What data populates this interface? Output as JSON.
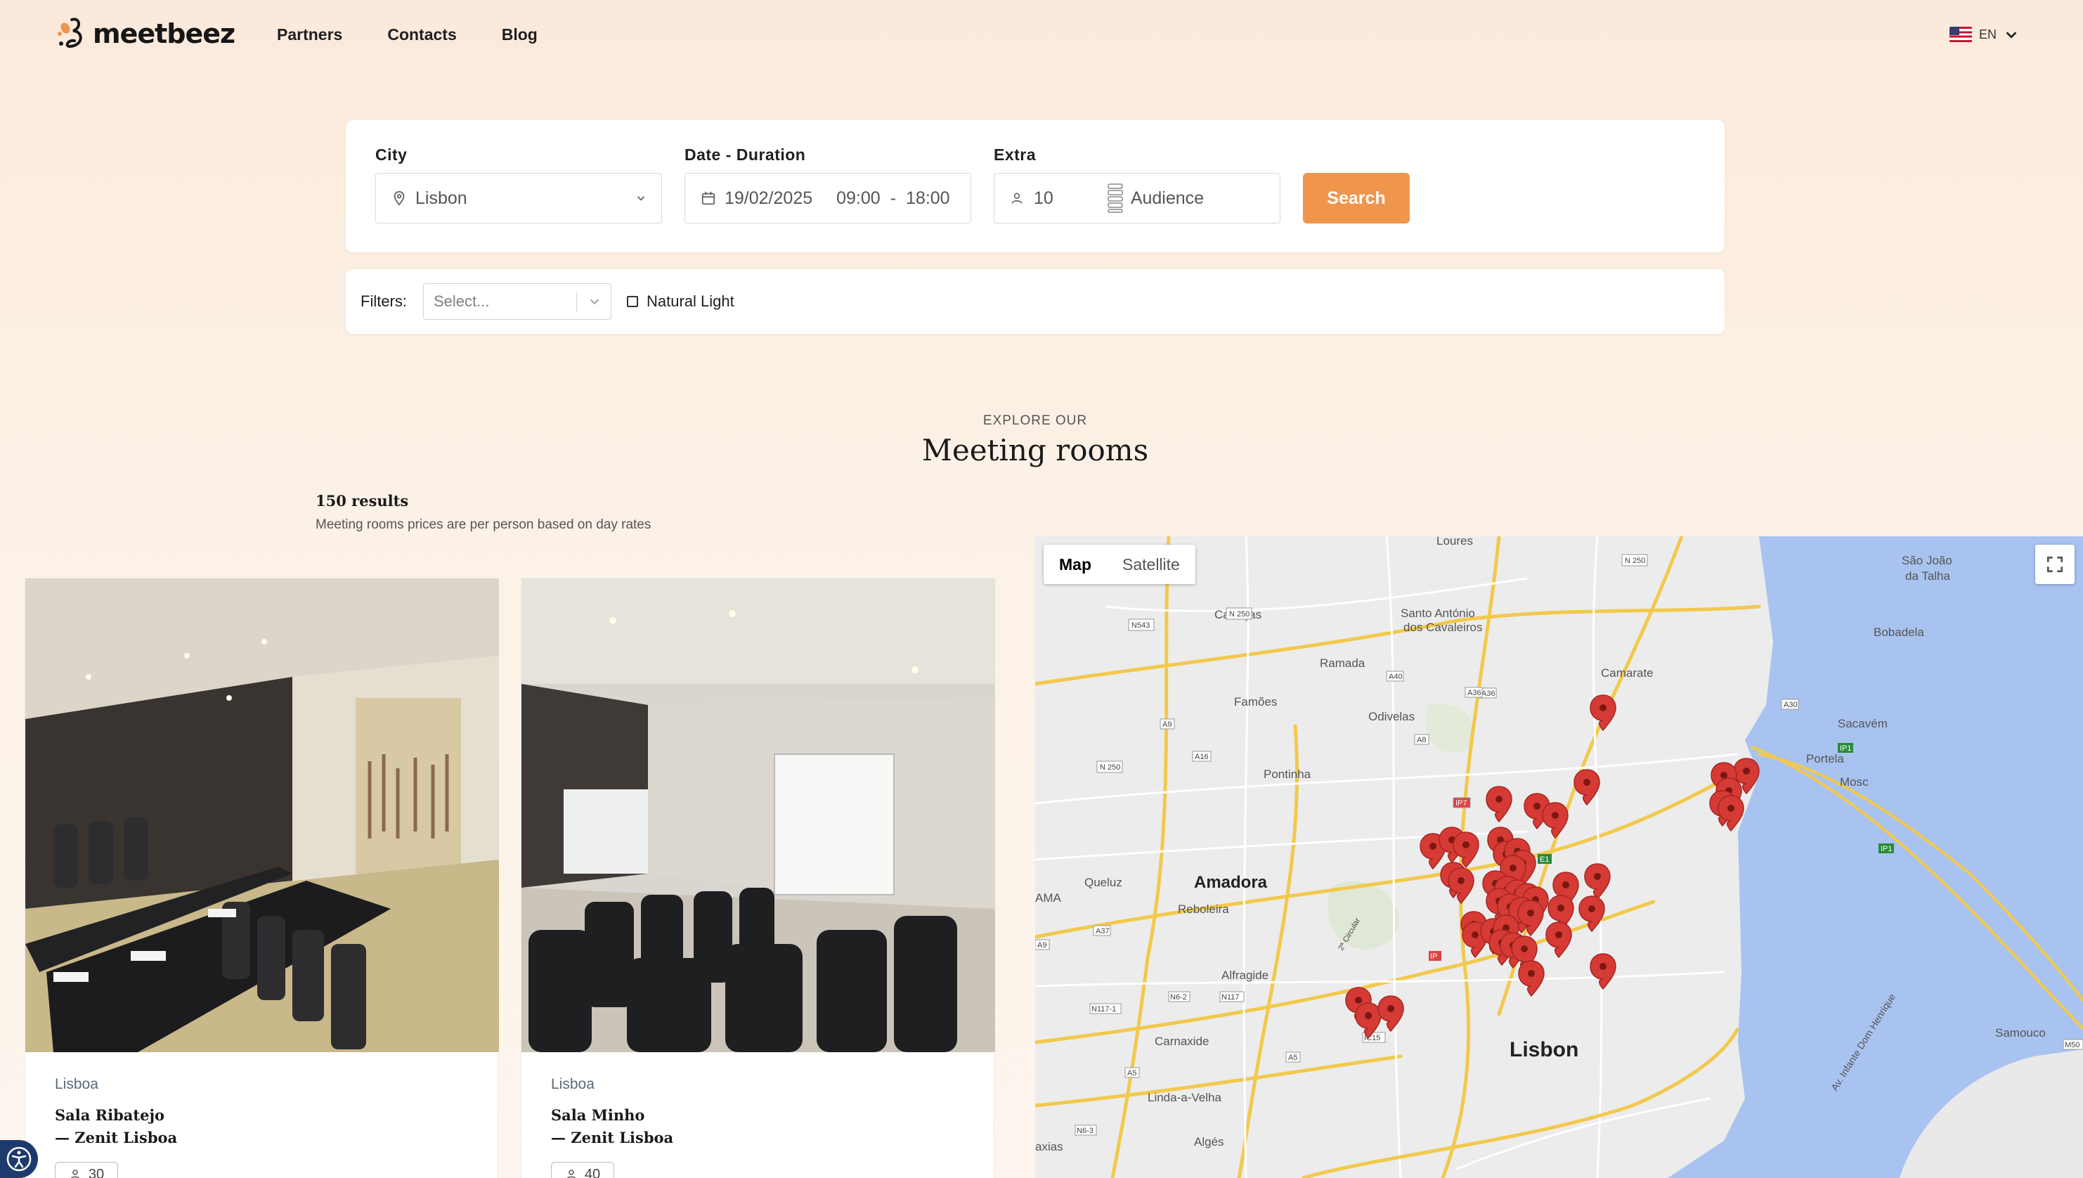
{
  "brand": {
    "name": "meetbeez",
    "accent": "#f0954c"
  },
  "nav": {
    "items": [
      "Partners",
      "Contacts",
      "Blog"
    ]
  },
  "language": {
    "code": "EN"
  },
  "search": {
    "city_label": "City",
    "city_value": "Lisbon",
    "date_label": "Date - Duration",
    "date_value": "19/02/2025",
    "time_start": "09:00",
    "time_sep": "-",
    "time_end": "18:00",
    "extra_label": "Extra",
    "people_value": "10",
    "layout_value": "Audience",
    "button_label": "Search"
  },
  "filters": {
    "label": "Filters:",
    "select_placeholder": "Select...",
    "natural_light_label": "Natural Light"
  },
  "section": {
    "eyebrow": "EXPLORE OUR",
    "title": "Meeting rooms",
    "results": "150 results",
    "note": "Meeting rooms prices are per person based on day rates"
  },
  "cards": [
    {
      "city": "Lisboa",
      "name_line1": "Sala Ribatejo",
      "name_line2": "— Zenit Lisboa",
      "capacity": "30"
    },
    {
      "city": "Lisboa",
      "name_line1": "Sala Minho",
      "name_line2": "— Zenit Lisboa",
      "capacity": "40"
    }
  ],
  "map": {
    "tabs": [
      "Map",
      "Satellite"
    ],
    "places": {
      "loures": "Loures",
      "sao_joao": "São João",
      "da_talha": "da Talha",
      "canecas": "Caneças",
      "santo_antonio": "Santo António",
      "dos_cavaleiros": "dos Cavaleiros",
      "bobadela": "Bobadela",
      "ramada": "Ramada",
      "camarate": "Camarate",
      "famoes": "Famões",
      "odivelas": "Odivelas",
      "sacavem": "Sacavém",
      "pontinha": "Pontinha",
      "portela": "Portela",
      "moscavide": "Mosc",
      "queluz": "Queluz",
      "amadora": "Amadora",
      "reboleira": "Reboleira",
      "ama": "AMA",
      "alfragide": "Alfragide",
      "carnaxide": "Carnaxide",
      "lisbon": "Lisbon",
      "linda_a_velha": "Linda-a-Velha",
      "alges": "Algés",
      "axias": "axias",
      "samouco": "Samouco",
      "infante": "Av. Infante Dom Henrique"
    },
    "roads": {
      "n250a": "N 250",
      "n250b": "N 250",
      "n250c": "N 250",
      "n543": "N543",
      "a40": "A40",
      "a36a": "A36",
      "a36b": "A36",
      "a30": "A30",
      "a9a": "A9",
      "a9b": "A9",
      "a16": "A16",
      "a8": "A8",
      "ip7": "IP7",
      "e1": "E1",
      "ip1a": "IP1",
      "ip1b": "IP1",
      "a37": "A37",
      "n62": "N6-2",
      "n117": "N117",
      "n1171": "N117-1",
      "ic15": "IC15",
      "a5a": "A5",
      "a5b": "A5",
      "n63": "N6-3",
      "m50": "M50",
      "ip": "IP",
      "crcular": "2ª Circular"
    }
  }
}
